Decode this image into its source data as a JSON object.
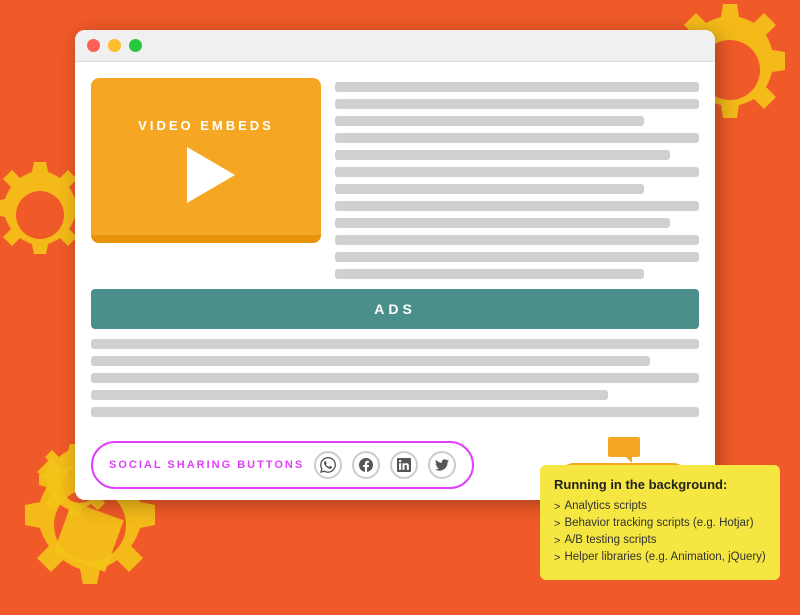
{
  "background_color": "#F05A28",
  "browser": {
    "traffic_lights": [
      "red",
      "yellow",
      "green"
    ],
    "video_embed": {
      "label": "VIDEO EMBEDS"
    },
    "ads_bar": {
      "label": "ADS"
    },
    "social_sharing": {
      "label": "SOCIAL SHARING BUTTONS",
      "icons": [
        "whatsapp",
        "facebook",
        "linkedin",
        "twitter"
      ]
    },
    "chat_widget": {
      "label": "CHAT WIDGET"
    }
  },
  "info_box": {
    "title": "Running in the background:",
    "items": [
      "Analytics scripts",
      "Behavior tracking scripts (e.g. Hotjar)",
      "A/B testing scripts",
      "Helper libraries (e.g. Animation, jQuery)"
    ]
  },
  "gears": {
    "color": "#F5C518",
    "accent": "#F5A623"
  }
}
